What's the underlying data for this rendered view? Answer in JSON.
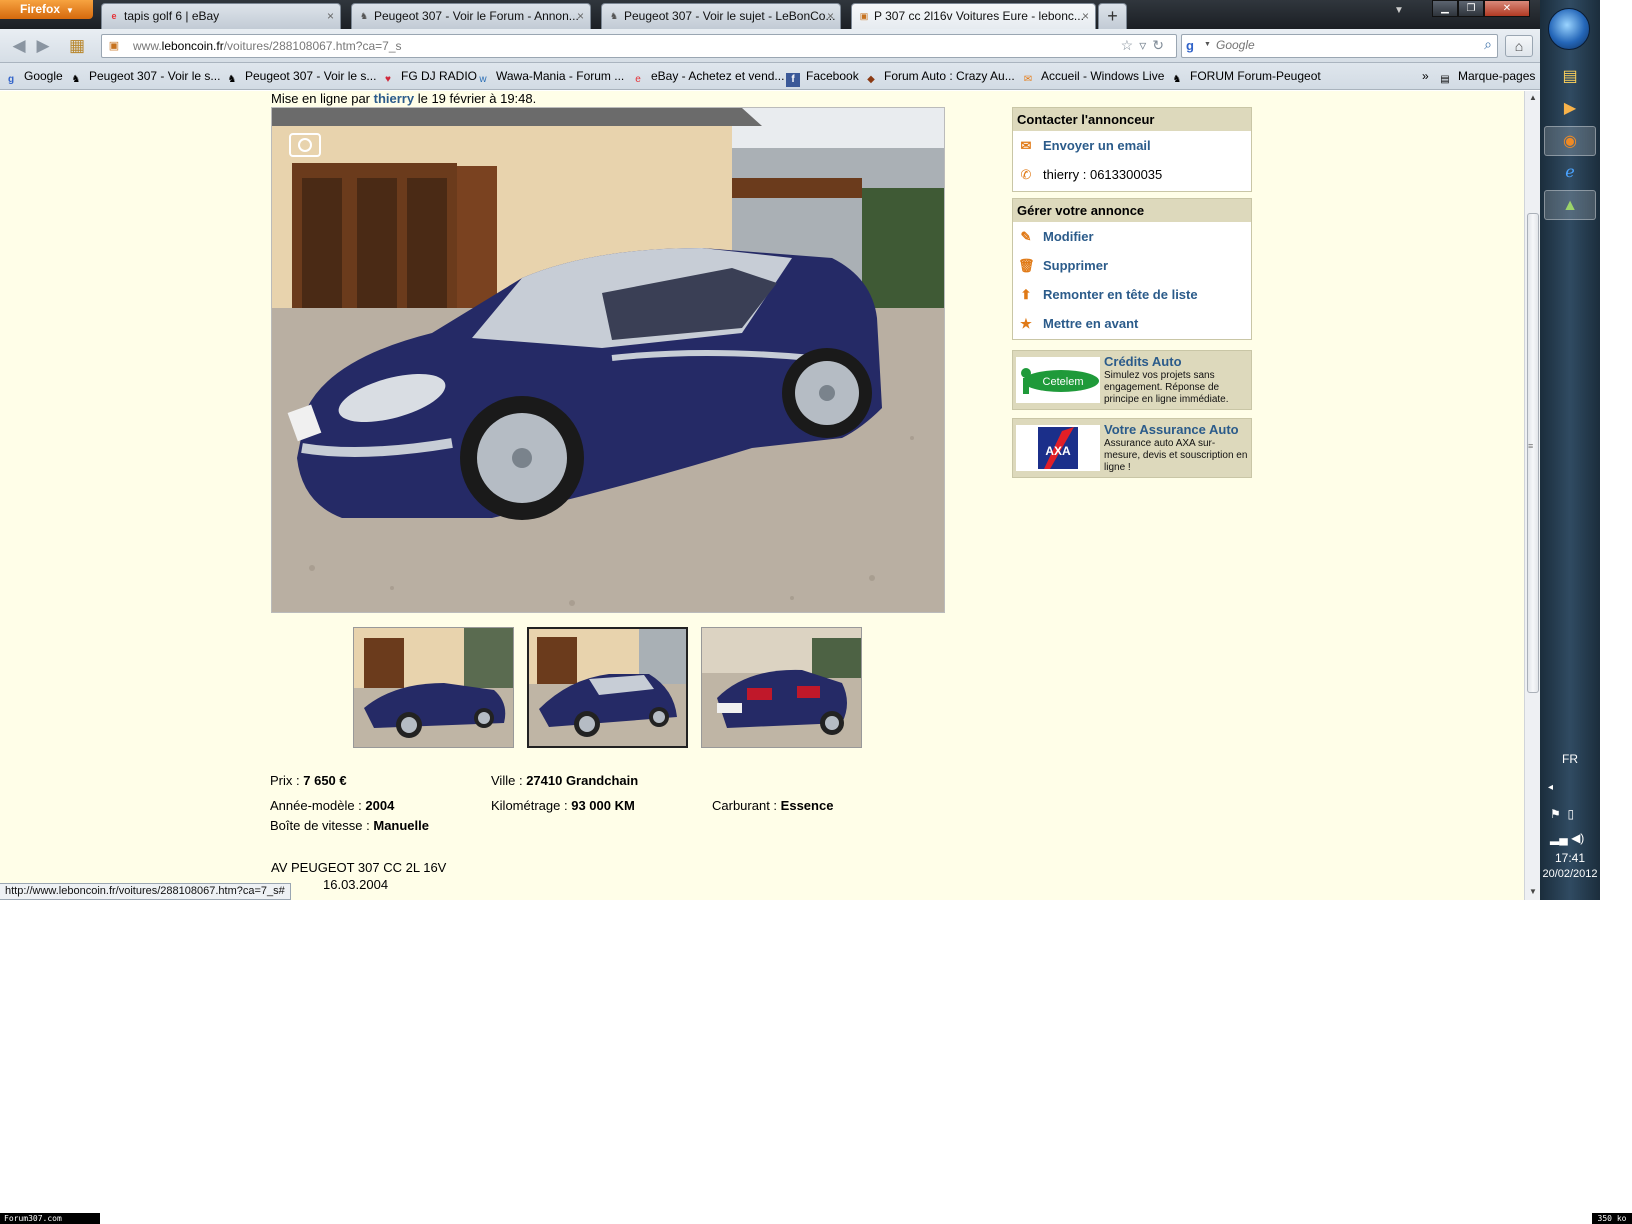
{
  "browser": {
    "app_menu_label": "Firefox",
    "tabs": [
      {
        "label": "tapis golf 6 | eBay",
        "icon": "ebay-icon"
      },
      {
        "label": "Peugeot 307 - Voir le Forum - Annon...",
        "icon": "peugeot-lion-icon"
      },
      {
        "label": "Peugeot 307 - Voir le sujet - LeBonCo...",
        "icon": "peugeot-lion-icon"
      },
      {
        "label": "P 307 cc 2l16v Voitures Eure - lebonc...",
        "icon": "leboncoin-icon"
      }
    ],
    "url_prefix": "www.",
    "url_domain": "leboncoin.fr",
    "url_path": "/voitures/288108067.htm?ca=7_s",
    "search_placeholder": "Google",
    "bookmarks": [
      {
        "label": "Google",
        "icon": "google-icon"
      },
      {
        "label": "Peugeot 307 - Voir le s...",
        "icon": "peugeot-lion-icon"
      },
      {
        "label": "Peugeot 307 - Voir le s...",
        "icon": "peugeot-lion-icon"
      },
      {
        "label": "FG DJ RADIO",
        "icon": "radio-icon"
      },
      {
        "label": "Wawa-Mania - Forum ...",
        "icon": "wawa-icon"
      },
      {
        "label": "eBay - Achetez et vend...",
        "icon": "ebay-icon"
      },
      {
        "label": "Facebook",
        "icon": "facebook-icon"
      },
      {
        "label": "Forum Auto : Crazy Au...",
        "icon": "forum-auto-icon"
      },
      {
        "label": "Accueil - Windows Live",
        "icon": "windows-live-icon"
      },
      {
        "label": "FORUM Forum-Peugeot",
        "icon": "peugeot-lion-icon"
      }
    ],
    "bookmarks_overflow": "»",
    "bookmarks_menu_label": "Marque-pages",
    "status_url": "http://www.leboncoin.fr/voitures/288108067.htm?ca=7_s#"
  },
  "listing": {
    "posted_prefix": "Mise en ligne par",
    "seller": "thierry",
    "posted_suffix": "le 19 février à 19:48.",
    "details": {
      "price_label": "Prix :",
      "price": "7 650 €",
      "city_label": "Ville :",
      "city": "27410 Grandchain",
      "year_label": "Année-modèle :",
      "year": "2004",
      "mileage_label": "Kilométrage :",
      "mileage": "93 000 KM",
      "fuel_label": "Carburant :",
      "fuel": "Essence",
      "gearbox_label": "Boîte de vitesse :",
      "gearbox": "Manuelle"
    },
    "description_line1": "AV PEUGEOT 307 CC 2L 16V",
    "description_line2": "16.03.2004",
    "thumbnails": [
      "thumb-1",
      "thumb-2",
      "thumb-3"
    ],
    "selected_thumbnail": 2
  },
  "sidebar": {
    "contact_title": "Contacter l'annonceur",
    "email_label": "Envoyer un email",
    "phone_name": "thierry :",
    "phone_number": "0613300035",
    "manage_title": "Gérer votre annonce",
    "manage_items": [
      {
        "label": "Modifier",
        "icon": "pencil-icon"
      },
      {
        "label": "Supprimer",
        "icon": "trash-icon"
      },
      {
        "label": "Remonter en tête de liste",
        "icon": "arrow-up-icon"
      },
      {
        "label": "Mettre en avant",
        "icon": "star-icon"
      }
    ],
    "promos": [
      {
        "title": "Crédits Auto",
        "desc": "Simulez vos projets sans engagement. Réponse de principe en ligne immédiate.",
        "logo_text": "Cetelem"
      },
      {
        "title": "Votre Assurance Auto",
        "desc": "Assurance auto AXA sur-mesure, devis et souscription en ligne !",
        "logo_text": "AXA"
      }
    ]
  },
  "taskbar": {
    "language": "FR",
    "time": "17:41",
    "date": "20/02/2012"
  },
  "watermarks": {
    "left": "Forum307.com",
    "right": "350 ko"
  },
  "colors": {
    "page_background": "#fffee8",
    "link_blue": "#2b5b8a",
    "box_header": "#ddd9bc",
    "accent_orange": "#e07a17"
  }
}
